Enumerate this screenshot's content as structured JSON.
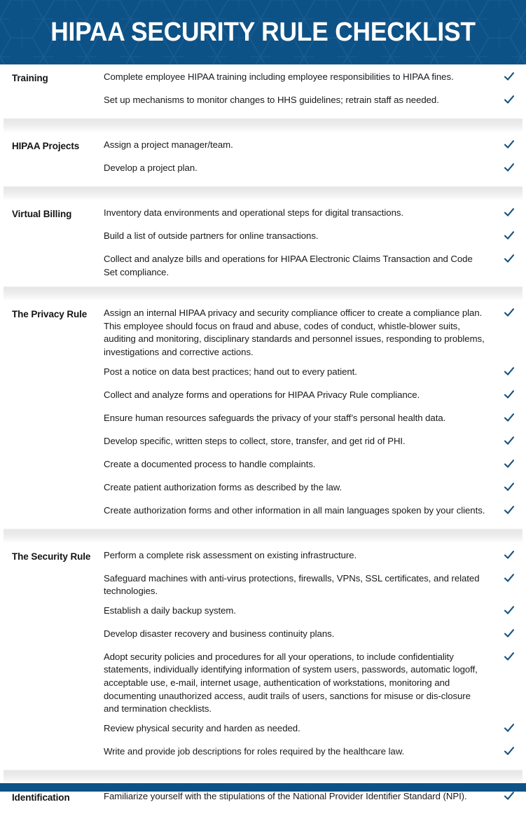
{
  "header": {
    "title": "HIPAA SECURITY RULE CHECKLIST",
    "background_color": "#0d5287"
  },
  "footer": {
    "background_color": "#0d5287"
  },
  "colors": {
    "brand_blue": "#0d5287",
    "check_blue": "#17527e",
    "separator_gray": "#e8e8e8",
    "text": "#1a1a1a"
  },
  "check_icon": "checkmark-icon",
  "sections": [
    {
      "label": "Training",
      "items": [
        {
          "text": "Complete employee HIPAA training including employee responsibilities to HIPAA fines.",
          "checked": true
        },
        {
          "text": "Set up mechanisms to monitor changes to HHS guidelines; retrain staff as needed.",
          "checked": true
        }
      ]
    },
    {
      "label": "HIPAA Projects",
      "items": [
        {
          "text": "Assign a project manager/team.",
          "checked": true
        },
        {
          "text": "Develop a project plan.",
          "checked": true
        }
      ]
    },
    {
      "label": "Virtual Billing",
      "items": [
        {
          "text": "Inventory data environments and operational steps for digital transactions.",
          "checked": true
        },
        {
          "text": "Build a list of outside partners for online transactions.",
          "checked": true
        },
        {
          "text": "Collect and analyze bills and operations for HIPAA Electronic Claims Transaction and Code Set compliance.",
          "checked": true
        }
      ]
    },
    {
      "label": "The Privacy Rule",
      "items": [
        {
          "text": "Assign an internal HIPAA privacy and security compliance officer to create a compliance plan. This employee should focus on fraud and abuse, codes of conduct, whistle-blower suits, auditing and monitoring, disciplinary standards and personnel issues, responding to problems, investigations and corrective actions.",
          "checked": true
        },
        {
          "text": "Post a notice on data best practices; hand out to every patient.",
          "checked": true
        },
        {
          "text": "Collect and analyze forms and operations for HIPAA Privacy Rule compliance.",
          "checked": true
        },
        {
          "text": "Ensure human resources safeguards the privacy of your staff’s personal health data.",
          "checked": true
        },
        {
          "text": "Develop specific, written steps to collect, store, transfer, and get rid of PHI.",
          "checked": true
        },
        {
          "text": "Create a documented process to handle complaints.",
          "checked": true
        },
        {
          "text": "Create patient authorization forms as described by the law.",
          "checked": true
        },
        {
          "text": "Create authorization forms and other information in all main languages spoken by your clients.",
          "checked": true
        }
      ]
    },
    {
      "label": "The Security Rule",
      "items": [
        {
          "text": "Perform a complete risk assessment on existing infrastructure.",
          "checked": true
        },
        {
          "text": "Safeguard machines with anti-virus protections, firewalls, VPNs, SSL certificates, and related technologies.",
          "checked": true
        },
        {
          "text": "Establish a daily backup system.",
          "checked": true
        },
        {
          "text": "Develop disaster recovery and business continuity plans.",
          "checked": true
        },
        {
          "text": "Adopt security policies and procedures for all your operations, to include confidentiality statements, individually identifying information of system users, passwords, automatic logoff, acceptable use, e-mail, internet usage, authentication of workstations, monitoring and documenting unauthorized access, audit trails of users, sanctions for misuse or dis-closure and termination checklists.",
          "checked": true
        },
        {
          "text": "Review physical security and harden as needed.",
          "checked": true
        },
        {
          "text": "Write and provide job descriptions for roles required by the healthcare law.",
          "checked": true
        }
      ]
    },
    {
      "label": "Identification",
      "items": [
        {
          "text": "Familiarize yourself with the stipulations of the National Provider Identifier Standard (NPI).",
          "checked": true
        }
      ]
    }
  ]
}
